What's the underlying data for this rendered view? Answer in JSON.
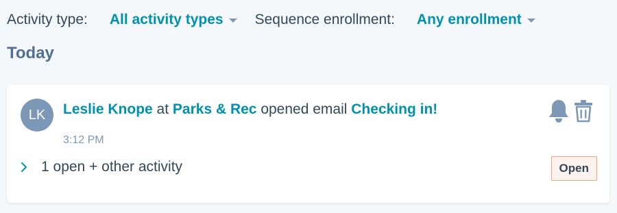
{
  "filters": {
    "activity_type_label": "Activity type:",
    "activity_type_value": "All activity types",
    "sequence_label": "Sequence enrollment:",
    "sequence_value": "Any enrollment"
  },
  "section": {
    "title": "Today"
  },
  "activity": {
    "avatar_initials": "LK",
    "contact_name": "Leslie Knope",
    "connector_at": "at",
    "company": "Parks & Rec",
    "action": "opened email",
    "email_subject": "Checking in!",
    "time": "3:12 PM",
    "summary": "1 open + other activity",
    "status_badge": "Open",
    "icons": [
      "bell-icon",
      "trash-icon",
      "chevron-right-icon"
    ]
  },
  "colors": {
    "link": "#0091ae",
    "text": "#33475b",
    "muted": "#7c98b6",
    "background": "#f5f8fa",
    "badge_border": "#f2a37f",
    "badge_bg": "#fdf3ee"
  }
}
